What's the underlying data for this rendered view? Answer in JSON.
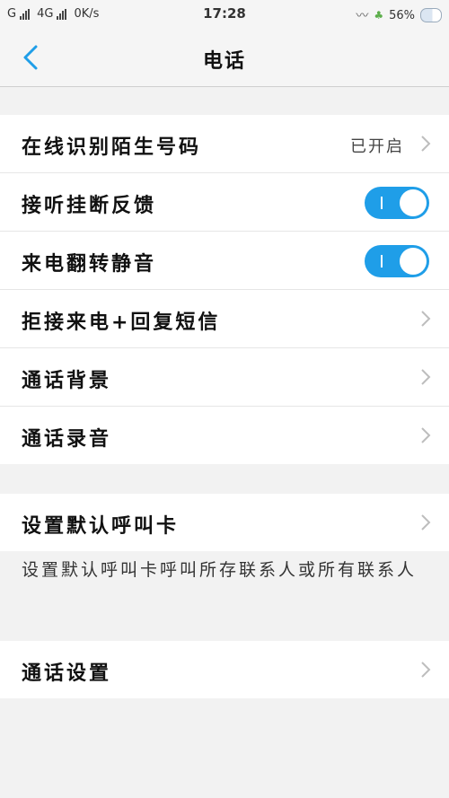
{
  "status": {
    "carrier1": "G",
    "carrier2": "4G",
    "speed": "0K/s",
    "time": "17:28",
    "battery": "56%"
  },
  "nav": {
    "title": "电话"
  },
  "group1": [
    {
      "label": "在线识别陌生号码",
      "value": "已开启",
      "type": "chevron"
    },
    {
      "label": "接听挂断反馈",
      "type": "toggle",
      "on": true
    },
    {
      "label": "来电翻转静音",
      "type": "toggle",
      "on": true
    },
    {
      "label": "拒接来电+回复短信",
      "type": "chevron"
    },
    {
      "label": "通话背景",
      "type": "chevron"
    },
    {
      "label": "通话录音",
      "type": "chevron"
    }
  ],
  "group2": {
    "label": "设置默认呼叫卡",
    "description": "设置默认呼叫卡呼叫所存联系人或所有联系人"
  },
  "group3": {
    "label": "通话设置"
  },
  "colors": {
    "accent": "#1f9ee8",
    "back": "#1f9ee8"
  }
}
